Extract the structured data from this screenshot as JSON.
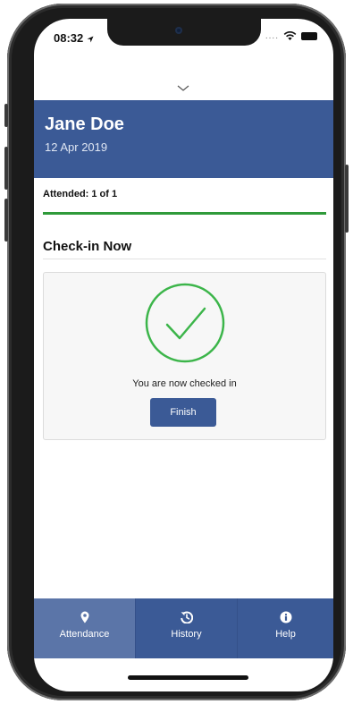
{
  "status_bar": {
    "time": "08:32",
    "signal": "...."
  },
  "header": {
    "name": "Jane Doe",
    "date": "12 Apr 2019"
  },
  "attendance": {
    "label": "Attended: 1 of 1",
    "progress_fraction": 1.0
  },
  "section": {
    "title": "Check-in Now"
  },
  "card": {
    "message": "You are now checked in",
    "finish_label": "Finish"
  },
  "tabs": [
    {
      "label": "Attendance",
      "icon": "map-pin-icon",
      "active": true
    },
    {
      "label": "History",
      "icon": "history-icon",
      "active": false
    },
    {
      "label": "Help",
      "icon": "info-icon",
      "active": false
    }
  ],
  "colors": {
    "brand": "#3b5a96",
    "active_tab": "#5b75a8",
    "success": "#2f9a3a",
    "check_green": "#3cb54a"
  }
}
